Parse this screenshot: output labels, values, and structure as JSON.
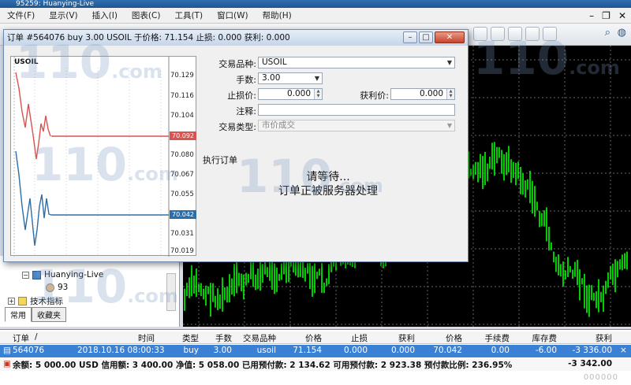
{
  "window": {
    "title": "95259: Huanying-Live"
  },
  "menu": [
    "文件(F)",
    "显示(V)",
    "插入(I)",
    "图表(C)",
    "工具(T)",
    "窗口(W)",
    "帮助(H)"
  ],
  "dialog": {
    "title": "订单 #564076 buy 3.00 USOIL 于价格: 71.154 止损: 0.000 获利: 0.000",
    "symbol_label": "USOIL",
    "price_ticks": [
      "70.129",
      "70.116",
      "70.104",
      "70.092",
      "70.080",
      "70.067",
      "70.055",
      "70.042",
      "70.031",
      "70.019"
    ],
    "form": {
      "symbol_label": "交易品种:",
      "symbol_value": "USOIL",
      "volume_label": "手数:",
      "volume_value": "3.00",
      "sl_label": "止损价:",
      "sl_value": "0.000",
      "tp_label": "获利价:",
      "tp_value": "0.000",
      "comment_label": "注释:",
      "comment_value": "",
      "type_label": "交易类型:",
      "type_value": "市价成交"
    },
    "section_title": "执行订单",
    "wait_line1": "请等待...",
    "wait_line2": "订单正被服务器处理"
  },
  "navigator": {
    "account": "Huanying-Live",
    "account_sub": "93",
    "indicators": "技术指标",
    "tabs": [
      "常用",
      "收藏夹"
    ]
  },
  "terminal": {
    "headers": [
      "订单",
      "/",
      "时间",
      "类型",
      "手数",
      "交易品种",
      "价格",
      "止损",
      "获利",
      "价格",
      "手续费",
      "库存费",
      "获利"
    ],
    "row": {
      "order": "564076",
      "time": "2018.10.16 08:00:33",
      "type": "buy",
      "lots": "3.00",
      "symbol": "usoil",
      "price": "71.154",
      "sl": "0.000",
      "tp": "0.000",
      "current_price": "70.042",
      "commission": "0.00",
      "swap": "-6.00",
      "profit": "-3 336.00"
    },
    "summary": "余额: 5 000.00 USD  信用额: 3 400.00  净值: 5 058.00  已用预付款: 2 134.62  可用预付款: 2 923.38  预付款比例: 236.95%",
    "summary_total": "-3 342.00",
    "dots": "000000"
  },
  "watermark": {
    "text": "110",
    "suffix": ".com"
  },
  "colors": {
    "bid_line": "#d9534f",
    "ask_line": "#2e6ea8",
    "candles": "#00ff00",
    "grid": "#666666"
  }
}
